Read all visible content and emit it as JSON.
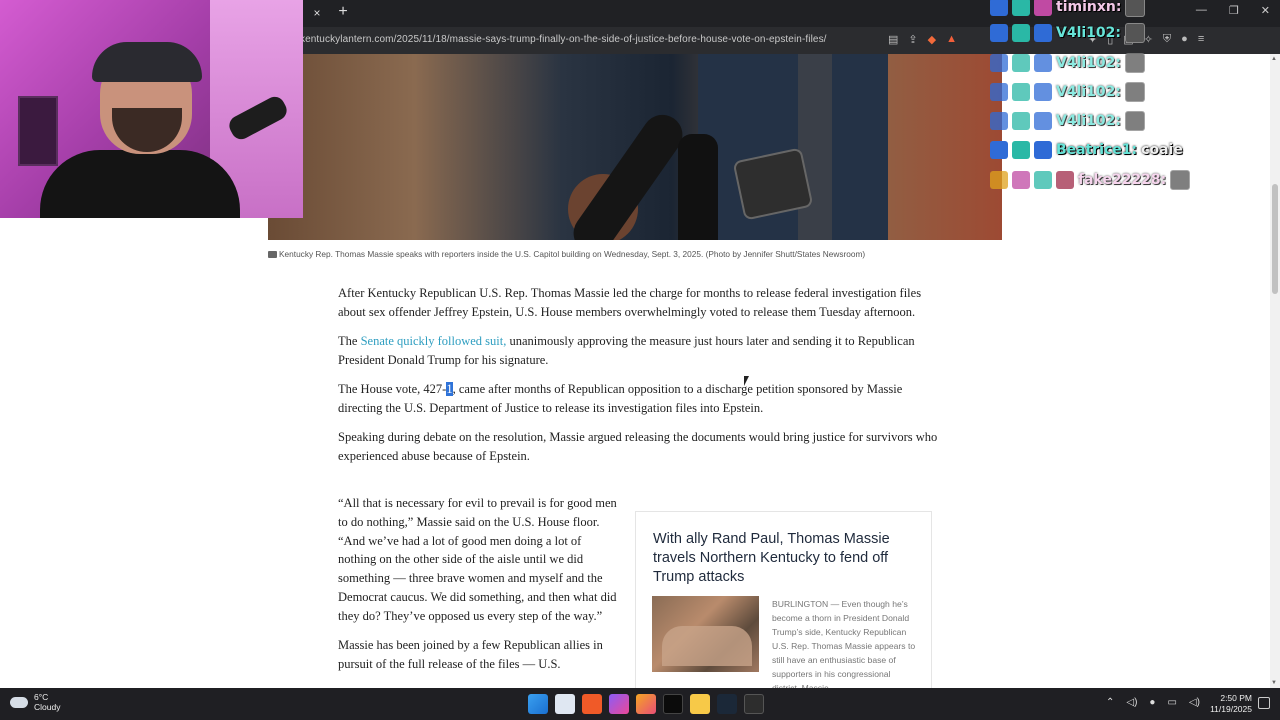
{
  "browser": {
    "url": "kentuckylantern.com/2025/11/18/massie-says-trump-finally-on-the-side-of-justice-before-house-vote-on-epstein-files/",
    "tab_close_glyph": "×",
    "tab_new_glyph": "+",
    "win_min": "—",
    "win_max": "❐",
    "win_close": "✕"
  },
  "chat": {
    "rows": [
      {
        "name": "timinxn:",
        "msg": ""
      },
      {
        "name": "V4li102:",
        "msg": ""
      },
      {
        "name": "V4li102:",
        "msg": ""
      },
      {
        "name": "V4li102:",
        "msg": ""
      },
      {
        "name": "V4li102:",
        "msg": ""
      },
      {
        "name": "Beatrice1:",
        "msg": "coaie"
      },
      {
        "name": "fake22228:",
        "msg": ""
      }
    ]
  },
  "article": {
    "caption": "Kentucky Rep. Thomas Massie speaks with reporters inside the U.S. Capitol building on Wednesday, Sept. 3, 2025. (Photo by Jennifer Shutt/States Newsroom)",
    "p1": "After Kentucky Republican U.S. Rep. Thomas Massie led the charge for months to release federal investigation files about sex offender Jeffrey Epstein, U.S. House members overwhelmingly voted to release them Tuesday afternoon.",
    "p2_pre": "The ",
    "p2_link": "Senate quickly followed suit,",
    "p2_post": " unanimously approving the measure just hours later and sending it to Republican President Donald Trump for his signature.",
    "p3_pre": "The House vote, 427-",
    "p3_hl": "1",
    "p3_post": ", came after months of Republican opposition to a discharge petition sponsored by Massie directing the U.S. Department of Justice to release its investigation files into Epstein.",
    "p4": "Speaking during debate on the resolution, Massie argued releasing the documents would bring justice for survivors who experienced abuse because of Epstein.",
    "p5": "“All that is necessary for evil to prevail is for good men to do nothing,” Massie said on the U.S. House floor. “And we’ve had a lot of good men doing a lot of nothing on the other side of the aisle until we did something — three brave women and myself and the Democrat caucus. We did something, and then what did they do? They’ve opposed us every step of the way.”",
    "p6": "Massie has been joined by a few Republican allies in pursuit of the full release of the files — U.S."
  },
  "promo": {
    "title": "With ally Rand Paul, Thomas Massie travels Northern Kentucky to fend off Trump attacks",
    "text": "BURLINGTON — Even though he’s become a thorn in President Donald Trump’s side, Kentucky Republican U.S. Rep. Thomas Massie appears to still have an enthusiastic base of supporters in his congressional district. Massie"
  },
  "taskbar": {
    "temp": "6°C",
    "weather": "Cloudy",
    "time": "2:50 PM",
    "date": "11/19/2025"
  },
  "colors": {
    "link": "#2e9ec0",
    "selection": "#2f73d8",
    "chat_name": "#66e4d8"
  }
}
